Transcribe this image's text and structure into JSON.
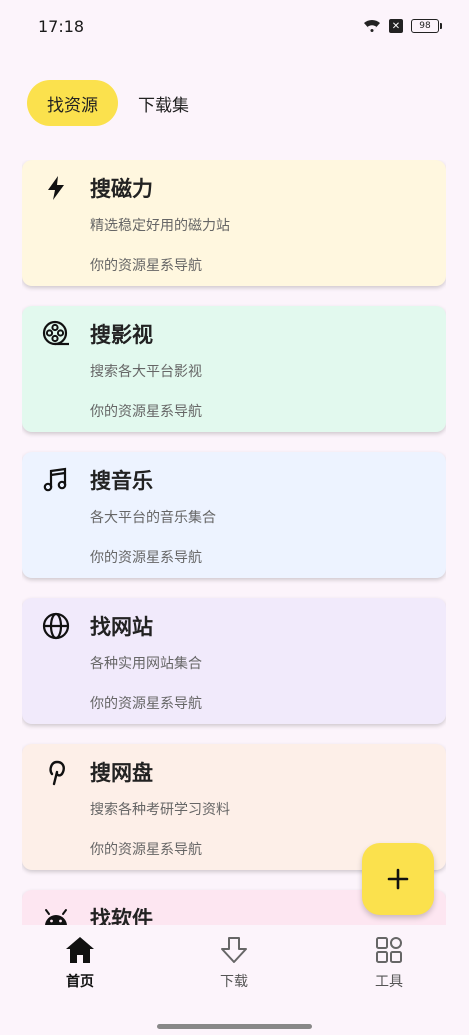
{
  "status_bar": {
    "time": "17:18",
    "battery": "98"
  },
  "tabs": [
    {
      "label": "找资源",
      "active": true
    },
    {
      "label": "下载集",
      "active": false
    }
  ],
  "cards": [
    {
      "title": "搜磁力",
      "desc": "精选稳定好用的磁力站",
      "foot": "你的资源星系导航",
      "icon": "lightning-icon",
      "bg": "#fff7df"
    },
    {
      "title": "搜影视",
      "desc": "搜索各大平台影视",
      "foot": "你的资源星系导航",
      "icon": "film-reel-icon",
      "bg": "#e2f9ee"
    },
    {
      "title": "搜音乐",
      "desc": "各大平台的音乐集合",
      "foot": "你的资源星系导航",
      "icon": "music-note-icon",
      "bg": "#edf3ff"
    },
    {
      "title": "找网站",
      "desc": "各种实用网站集合",
      "foot": "你的资源星系导航",
      "icon": "globe-icon",
      "bg": "#f1eafb"
    },
    {
      "title": "搜网盘",
      "desc": "搜索各种考研学习资料",
      "foot": "你的资源星系导航",
      "icon": "pinterest-icon",
      "bg": "#fdefe8"
    },
    {
      "title": "找软件",
      "desc": "",
      "foot": "",
      "icon": "android-icon",
      "bg": "#fde6f1"
    }
  ],
  "fab": {
    "icon": "plus-icon"
  },
  "bottom_nav": [
    {
      "label": "首页",
      "icon": "home-icon",
      "active": true
    },
    {
      "label": "下载",
      "icon": "download-icon",
      "active": false
    },
    {
      "label": "工具",
      "icon": "grid-icon",
      "active": false
    }
  ],
  "colors": {
    "accent": "#fbe14d",
    "background": "#fcf4fb"
  }
}
